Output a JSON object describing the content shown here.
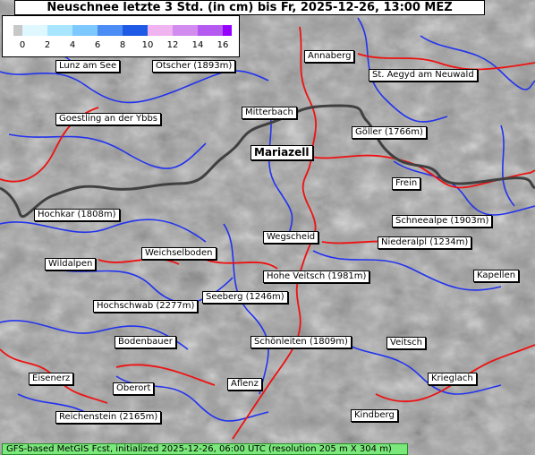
{
  "title": "Neuschnee letzte 3 Std. (in cm) bis Fr, 2025-12-26, 13:00 MEZ",
  "legend": {
    "ticks": [
      "0",
      "2",
      "4",
      "6",
      "8",
      "10",
      "12",
      "14",
      "16"
    ],
    "colors": [
      "#c8c8c8",
      "#dff7ff",
      "#a8e6ff",
      "#7cc8ff",
      "#4b8cf5",
      "#1e5ae6",
      "#f0b4f0",
      "#d28cf0",
      "#b45af0",
      "#9600ff"
    ]
  },
  "places": [
    {
      "name": "Lunz am See"
    },
    {
      "name": "Ötscher (1893m)"
    },
    {
      "name": "Annaberg"
    },
    {
      "name": "St. Aegyd am Neuwald"
    },
    {
      "name": "Goestling an der Ybbs"
    },
    {
      "name": "Mitterbach"
    },
    {
      "name": "Göller (1766m)"
    },
    {
      "name": "Mariazell"
    },
    {
      "name": "Frein"
    },
    {
      "name": "Hochkar (1808m)"
    },
    {
      "name": "Schneealpe (1903m)"
    },
    {
      "name": "Wegscheid"
    },
    {
      "name": "Niederalpl (1234m)"
    },
    {
      "name": "Weichselboden"
    },
    {
      "name": "Wildalpen"
    },
    {
      "name": "Hohe Veitsch (1981m)"
    },
    {
      "name": "Kapellen"
    },
    {
      "name": "Seeberg (1246m)"
    },
    {
      "name": "Hochschwab (2277m)"
    },
    {
      "name": "Bodenbauer"
    },
    {
      "name": "Schönleiten (1809m)"
    },
    {
      "name": "Veitsch"
    },
    {
      "name": "Eisenerz"
    },
    {
      "name": "Aflenz"
    },
    {
      "name": "Krieglach"
    },
    {
      "name": "Oberort"
    },
    {
      "name": "Reichenstein (2165m)"
    },
    {
      "name": "Kindberg"
    }
  ],
  "footer": "GFS-based MetGIS Fcst, initialized 2025-12-26, 06:00 UTC  (resolution 205 m X 304 m)"
}
